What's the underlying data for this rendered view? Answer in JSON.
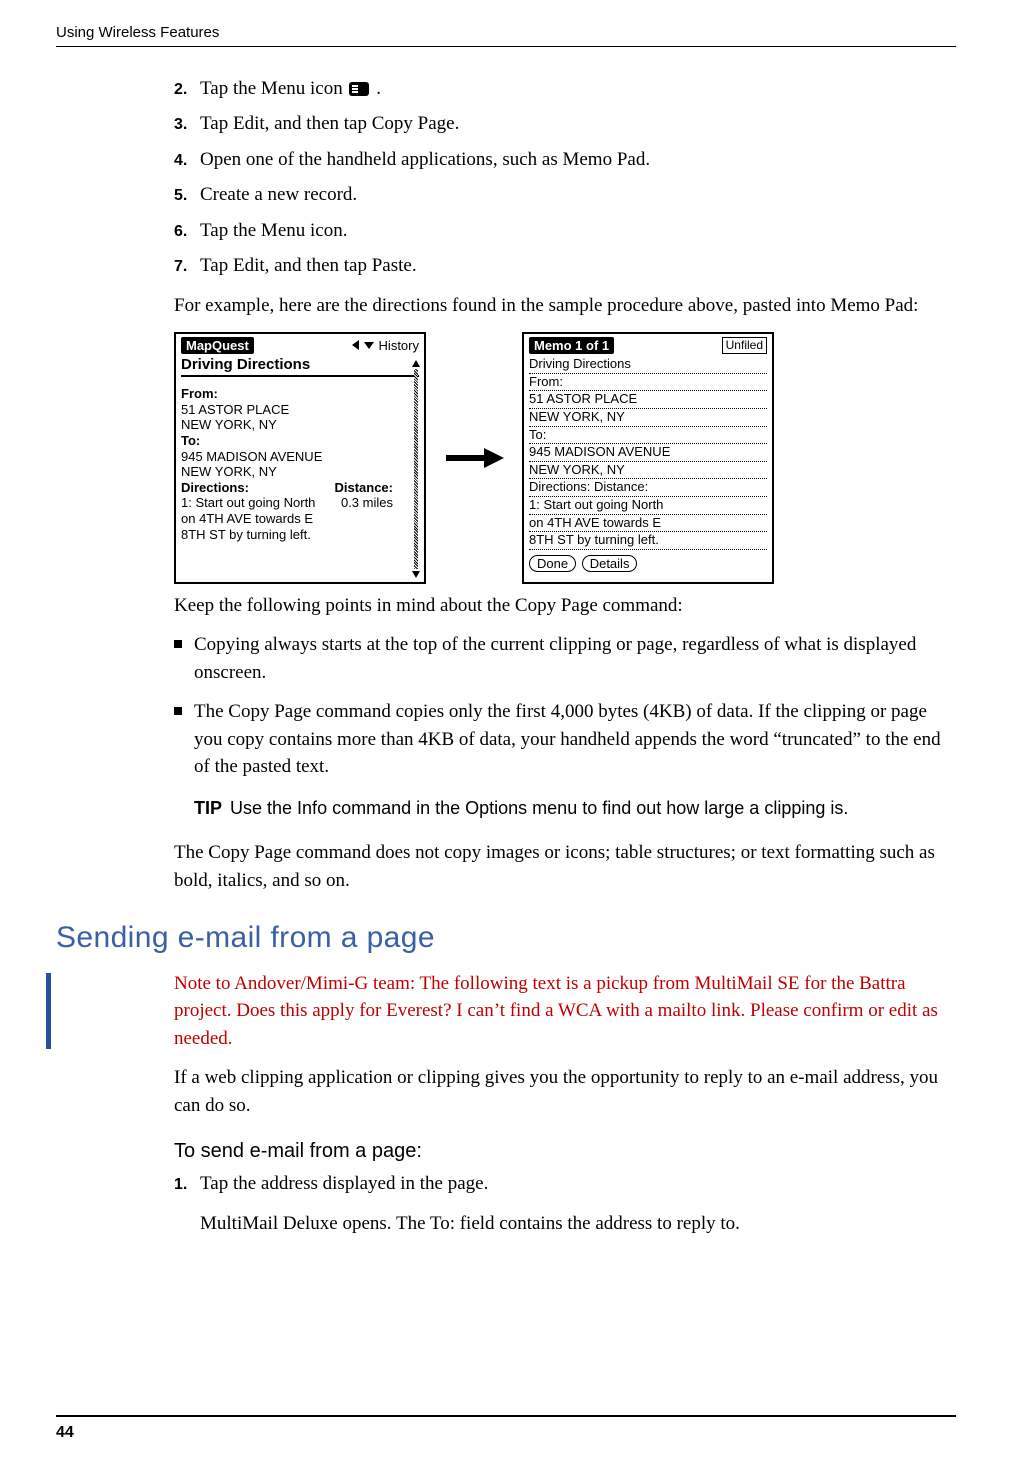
{
  "header": {
    "running_head": "Using Wireless Features"
  },
  "steps_a": [
    {
      "n": "2.",
      "text": "Tap the Menu icon",
      "icon": true,
      "suffix": " ."
    },
    {
      "n": "3.",
      "text": "Tap Edit, and then tap Copy Page."
    },
    {
      "n": "4.",
      "text": "Open one of the handheld applications, such as Memo Pad."
    },
    {
      "n": "5.",
      "text": "Create a new record."
    },
    {
      "n": "6.",
      "text": "Tap the Menu icon."
    },
    {
      "n": "7.",
      "text": "Tap Edit, and then tap Paste."
    }
  ],
  "para_example": "For example, here are the directions found in the sample procedure above, pasted into Memo Pad:",
  "mapquest": {
    "title": "MapQuest",
    "history": "History",
    "heading": "Driving Directions",
    "from_label": "From:",
    "from_l1": "51 ASTOR PLACE",
    "from_l2": "NEW YORK, NY",
    "to_label": "To:",
    "to_l1": "945 MADISON AVENUE",
    "to_l2": "NEW YORK, NY",
    "dir_label": "Directions:",
    "dist_label": "Distance:",
    "step1_a": "1: Start out going North",
    "step1_b": "on 4TH AVE towards E",
    "step1_c": "8TH ST by turning left.",
    "dist1": "0.3 miles"
  },
  "memo": {
    "title": "Memo 1 of 1",
    "category": "Unfiled",
    "lines": [
      "Driving Directions",
      "From:",
      "51 ASTOR PLACE",
      "NEW YORK, NY",
      "To:",
      "945 MADISON AVENUE",
      "NEW YORK, NY",
      "Directions: Distance:",
      "1:  Start out going North",
      "on 4TH AVE towards E",
      "8TH ST by turning left."
    ],
    "btn_done": "Done",
    "btn_details": "Details"
  },
  "para_keep": "Keep the following points in mind about the Copy Page command:",
  "bullets": [
    "Copying always starts at the top of the current clipping or page, regardless of what is displayed onscreen.",
    "The Copy Page command copies only the first 4,000 bytes (4KB) of data. If the clipping or page you copy contains more than 4KB of data, your handheld appends the word “truncated” to the end of the pasted text."
  ],
  "tip": {
    "label": "TIP",
    "text": "Use the Info command in the Options menu to find out how large a clipping is."
  },
  "para_nocopy": "The Copy Page command does not copy images or icons; table structures; or text formatting such as bold, italics, and so on.",
  "section2": {
    "title": "Sending e-mail from a page",
    "revnote": "Note to Andover/Mimi-G team: The following text is a pickup from MultiMail SE for the Battra project. Does this apply for Everest? I can’t find a WCA with a mailto link. Please confirm or edit as needed.",
    "intro": "If a web clipping application or clipping gives you the opportunity to reply to an e-mail address, you can do so.",
    "subhead": "To send e-mail from a page:",
    "step1_n": "1.",
    "step1_t": "Tap the address displayed in the page.",
    "step1_after": "MultiMail Deluxe opens. The To: field contains the address to reply to."
  },
  "footer": {
    "page": "44"
  }
}
